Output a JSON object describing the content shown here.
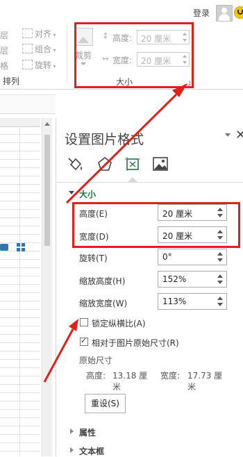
{
  "header": {
    "login_label": "登录"
  },
  "ribbon": {
    "arrange_items": [
      {
        "label": "层",
        "icon": "bring-forward-icon"
      },
      {
        "label": "层",
        "icon": "send-backward-icon"
      },
      {
        "label": "格",
        "icon": "selection-pane-icon"
      }
    ],
    "align_items": [
      {
        "label": "对齐",
        "icon": "align-icon"
      },
      {
        "label": "组合",
        "icon": "group-icon"
      },
      {
        "label": "旋转",
        "icon": "rotate-icon"
      }
    ],
    "arrange_group_label": "排列",
    "crop_label": "裁剪",
    "height_label": "高度:",
    "height_value": "20 厘米",
    "width_label": "宽度:",
    "width_value": "20 厘米",
    "size_group_label": "大小"
  },
  "pane": {
    "title": "设置图片格式",
    "tabs": [
      {
        "icon": "fill-line-icon"
      },
      {
        "icon": "effects-pentagon-icon"
      },
      {
        "icon": "size-properties-icon"
      },
      {
        "icon": "picture-icon"
      }
    ],
    "size_section": {
      "title": "大小",
      "height": {
        "label": "高度(E)",
        "value": "20 厘米"
      },
      "width": {
        "label": "宽度(D)",
        "value": "20 厘米"
      },
      "rotation": {
        "label": "旋转(T)",
        "value": "0°"
      },
      "scale_height": {
        "label": "缩放高度(H)",
        "value": "152%"
      },
      "scale_width": {
        "label": "缩放宽度(W)",
        "value": "113%"
      },
      "lock_aspect": {
        "label": "锁定纵横比(A)",
        "checked": false
      },
      "relative_original": {
        "label": "相对于图片原始尺寸(R)",
        "checked": true
      },
      "original_size_title": "原始尺寸",
      "original_height_label": "高度:",
      "original_height_value": "13.18 厘",
      "original_height_unit": "米",
      "original_width_label": "宽度:",
      "original_width_value": "17.73 厘",
      "original_width_unit": "米",
      "reset_label": "重设(S)"
    },
    "properties_section": {
      "title": "属性"
    },
    "textbox_section": {
      "title": "文本框"
    }
  },
  "colors": {
    "accent_green": "#217346",
    "highlight_red": "#e0211b"
  }
}
